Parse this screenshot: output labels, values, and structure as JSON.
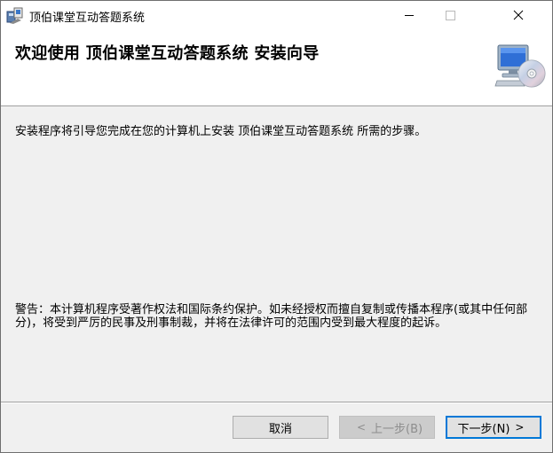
{
  "window": {
    "title": "顶伯课堂互动答题系统"
  },
  "banner": {
    "heading": "欢迎使用 顶伯课堂互动答题系统 安装向导",
    "graphic_icon": "computer-cd-icon"
  },
  "body": {
    "intro": "安装程序将引导您完成在您的计算机上安装 顶伯课堂互动答题系统 所需的步骤。",
    "warning": "警告：本计算机程序受著作权法和国际条约保护。如未经授权而擅自复制或传播本程序(或其中任何部分)，将受到严厉的民事及刑事制裁，并将在法律许可的范围内受到最大程度的起诉。"
  },
  "buttons": {
    "cancel": "取消",
    "back": "上一步(B)",
    "back_left_arrow": "<",
    "next": "下一步(N)",
    "next_right_arrow": ">"
  },
  "colors": {
    "window_bg": "#f0f0f0",
    "banner_bg": "#ffffff",
    "focus_border": "#0078d7"
  }
}
